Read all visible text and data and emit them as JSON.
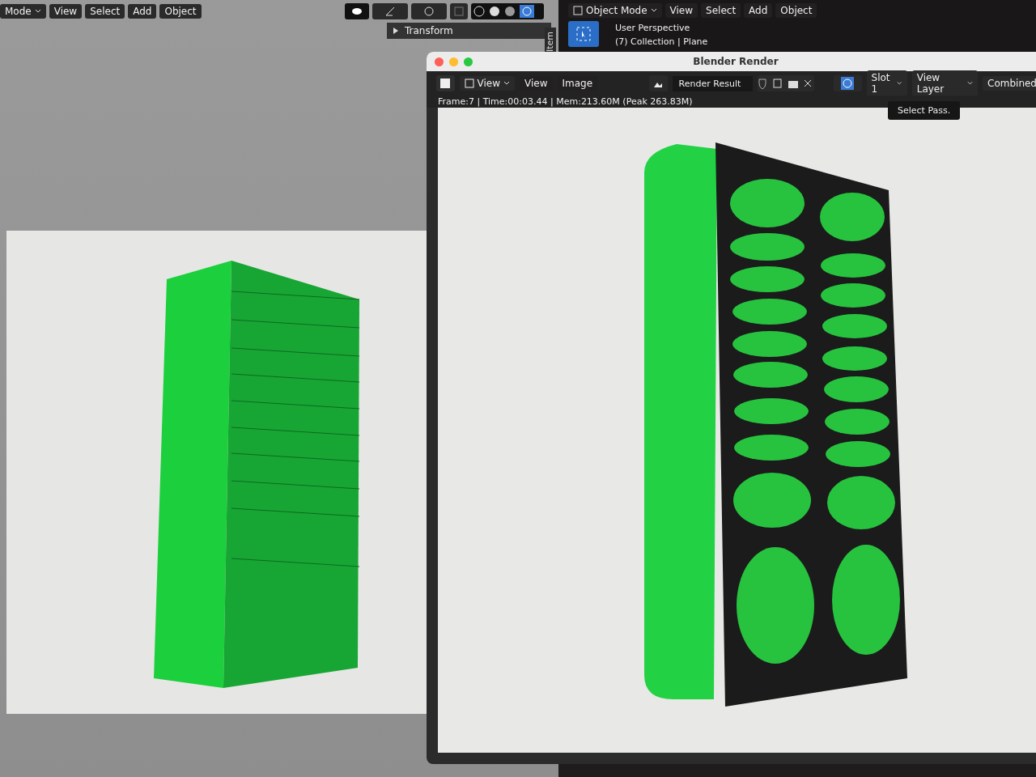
{
  "left_viewport": {
    "mode_menu": "Mode",
    "menus": [
      "View",
      "Select",
      "Add",
      "Object"
    ],
    "panel": {
      "title": "Transform",
      "expanded": false
    },
    "sidebar_tab": "Item"
  },
  "right_viewport": {
    "mode_menu": "Object Mode",
    "menus": [
      "View",
      "Select",
      "Add",
      "Object"
    ],
    "info": [
      "User Perspective",
      "(7) Collection | Plane"
    ]
  },
  "render_window": {
    "title": "Blender Render",
    "view_dropdown": "View",
    "menus": [
      "View",
      "Image"
    ],
    "image_name": "Render Result",
    "slot": "Slot 1",
    "layer": "View Layer",
    "pass": "Combined",
    "status": "Frame:7 | Time:00:03.44 | Mem:213.60M (Peak 263.83M)",
    "tooltip": "Select Pass."
  }
}
